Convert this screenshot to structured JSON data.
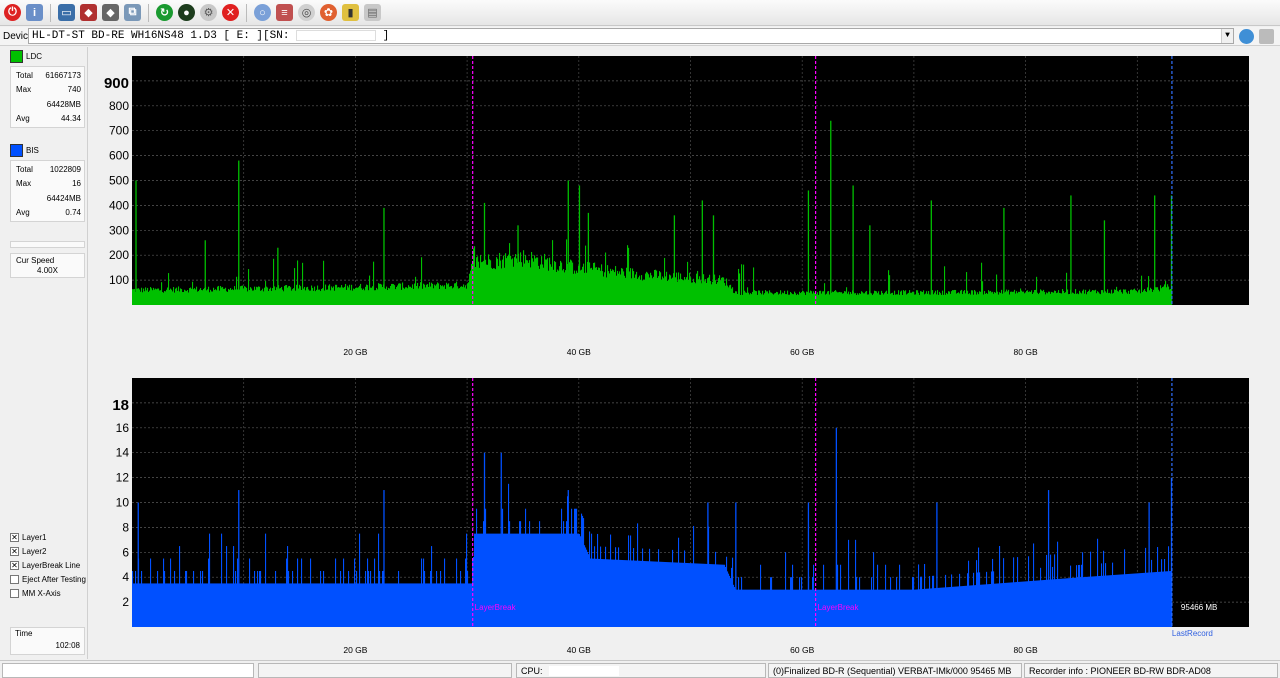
{
  "device": {
    "label": "Device:",
    "drive": "HL-DT-ST BD-RE  WH16NS48  1.D3 [ E: ][SN:",
    "drive_suffix": "]"
  },
  "toolbar": {
    "icons": [
      "power-icon",
      "info-icon",
      "drive-info-icon",
      "disc-erase-icon",
      "disc-burn-icon",
      "copy-icon",
      "refresh-icon",
      "start-test-icon",
      "settings-icon",
      "stop-icon",
      "disc-icon",
      "scan-icon",
      "blank-disc-icon",
      "burn-icon",
      "chart-icon",
      "save-icon"
    ]
  },
  "left_panel": {
    "ldc": {
      "label": "LDC",
      "color": "#00c000",
      "total_label": "Total",
      "total": "61667173",
      "max_label": "Max",
      "max": "740",
      "max_pos": "64428MB",
      "avg_label": "Avg",
      "avg": "44.34"
    },
    "bis": {
      "label": "BIS",
      "color": "#0050ff",
      "total_label": "Total",
      "total": "1022809",
      "max_label": "Max",
      "max": "16",
      "max_pos": "64424MB",
      "avg_label": "Avg",
      "avg": "0.74"
    },
    "speed": {
      "label": "Cur Speed",
      "value": "4.00X"
    },
    "checkboxes": [
      {
        "label": "Layer1",
        "checked": true
      },
      {
        "label": "Layer2",
        "checked": true
      },
      {
        "label": "LayerBreak Line",
        "checked": true
      },
      {
        "label": "Eject After Testing",
        "checked": false
      },
      {
        "label": "MM X-Axis",
        "checked": false
      }
    ],
    "time": {
      "label": "Time",
      "value": "102:08"
    }
  },
  "chart_data": [
    {
      "type": "area",
      "series": [
        {
          "name": "LDC",
          "color": "#00c000"
        }
      ],
      "x_unit": "GB",
      "xlim": [
        0,
        100
      ],
      "ylim": [
        0,
        1000
      ],
      "yticks": [
        100,
        200,
        300,
        400,
        500,
        600,
        700,
        800,
        900
      ],
      "ytick_labels": [
        "100",
        "200",
        "300",
        "400",
        "500",
        "600",
        "700",
        "800",
        "900"
      ],
      "xticks": [
        20,
        40,
        60,
        80
      ],
      "xtick_labels": [
        "20 GB",
        "40 GB",
        "60 GB",
        "80 GB"
      ],
      "baseline_profile": [
        [
          0,
          60
        ],
        [
          15,
          68
        ],
        [
          30,
          80
        ],
        [
          30.5,
          170
        ],
        [
          35,
          190
        ],
        [
          39,
          155
        ],
        [
          45,
          125
        ],
        [
          53,
          100
        ],
        [
          54,
          50
        ],
        [
          70,
          50
        ],
        [
          90,
          55
        ],
        [
          92.5,
          70
        ]
      ],
      "spikes": [
        [
          0.3,
          500
        ],
        [
          9.5,
          580
        ],
        [
          6.5,
          260
        ],
        [
          13,
          230
        ],
        [
          22.5,
          390
        ],
        [
          31.5,
          410
        ],
        [
          34.5,
          320
        ],
        [
          39,
          500
        ],
        [
          40,
          480
        ],
        [
          40.8,
          370
        ],
        [
          48.5,
          360
        ],
        [
          51,
          420
        ],
        [
          52,
          360
        ],
        [
          60.5,
          460
        ],
        [
          62.5,
          740
        ],
        [
          64.5,
          480
        ],
        [
          66,
          320
        ],
        [
          71.5,
          420
        ],
        [
          78,
          390
        ],
        [
          84,
          440
        ],
        [
          87,
          340
        ],
        [
          91.5,
          440
        ],
        [
          93,
          440
        ]
      ],
      "grid": true,
      "layer_breaks": [
        30.5,
        61.2
      ],
      "end_marker": 93.1,
      "data_end": 93.1
    },
    {
      "type": "bar",
      "series": [
        {
          "name": "BIS",
          "color": "#0050ff"
        }
      ],
      "x_unit": "GB",
      "xlim": [
        0,
        100
      ],
      "ylim": [
        0,
        20
      ],
      "yticks": [
        2,
        4,
        6,
        8,
        10,
        12,
        14,
        16,
        18
      ],
      "ytick_labels": [
        "2",
        "4",
        "6",
        "8",
        "10",
        "12",
        "14",
        "16",
        "18"
      ],
      "xticks": [
        20,
        40,
        60,
        80
      ],
      "xtick_labels": [
        "20 GB",
        "40 GB",
        "60 GB",
        "80 GB"
      ],
      "baseline_profile": [
        [
          0,
          3.5
        ],
        [
          30.5,
          3.5
        ],
        [
          30.6,
          7.5
        ],
        [
          40,
          7.5
        ],
        [
          41,
          5.5
        ],
        [
          53,
          5
        ],
        [
          54,
          3
        ],
        [
          70,
          3
        ],
        [
          85,
          4
        ],
        [
          93,
          4.5
        ]
      ],
      "spikes": [
        [
          0.5,
          10
        ],
        [
          9.5,
          11
        ],
        [
          22.5,
          11
        ],
        [
          31.5,
          14
        ],
        [
          33,
          14
        ],
        [
          39,
          11
        ],
        [
          51.5,
          10
        ],
        [
          54,
          10
        ],
        [
          60.5,
          10
        ],
        [
          63,
          16
        ],
        [
          72,
          10
        ],
        [
          82,
          11
        ],
        [
          91,
          10
        ],
        [
          93,
          12
        ]
      ],
      "grid": true,
      "layer_breaks": [
        30.5,
        61.2
      ],
      "layer_break_label": "LayerBreak",
      "end_marker": 93.1,
      "end_label": "LastRecord",
      "end_value_label": "95466 MB",
      "data_end": 93.1
    }
  ],
  "status": {
    "cpu_label": "CPU:",
    "disc_info": "(0)Finalized  BD-R (Sequential)  VERBAT-IMk/000  95465 MB",
    "recorder": "Recorder info : PIONEER      BD-RW  BDR-AD08"
  }
}
